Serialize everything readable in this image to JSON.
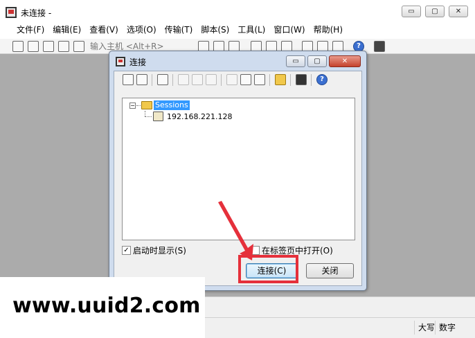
{
  "app": {
    "title": "未连接 -",
    "window_buttons": [
      "▭",
      "▢",
      "✕"
    ]
  },
  "menu": [
    "文件(F)",
    "编辑(E)",
    "查看(V)",
    "选项(O)",
    "传输(T)",
    "脚本(S)",
    "工具(L)",
    "窗口(W)",
    "帮助(H)"
  ],
  "toolbar": {
    "host_placeholder": "输入主机 <Alt+R>"
  },
  "status": {
    "caps": "大写",
    "num": "数字"
  },
  "dialog": {
    "title": "连接",
    "window_buttons": [
      "▭",
      "▢",
      "✕"
    ],
    "tree": {
      "root": "Sessions",
      "toggle": "−",
      "children": [
        "192.168.221.128"
      ]
    },
    "show_on_startup": {
      "label": "启动时显示(S)",
      "checked": true,
      "mark": "✓"
    },
    "open_in_tab": {
      "label": "在标签页中打开(O)",
      "checked": false
    },
    "connect_button": "连接(C)",
    "close_button": "关闭"
  },
  "annotation": {
    "color": "#e5303b"
  },
  "watermark": "www.uuid2.com"
}
